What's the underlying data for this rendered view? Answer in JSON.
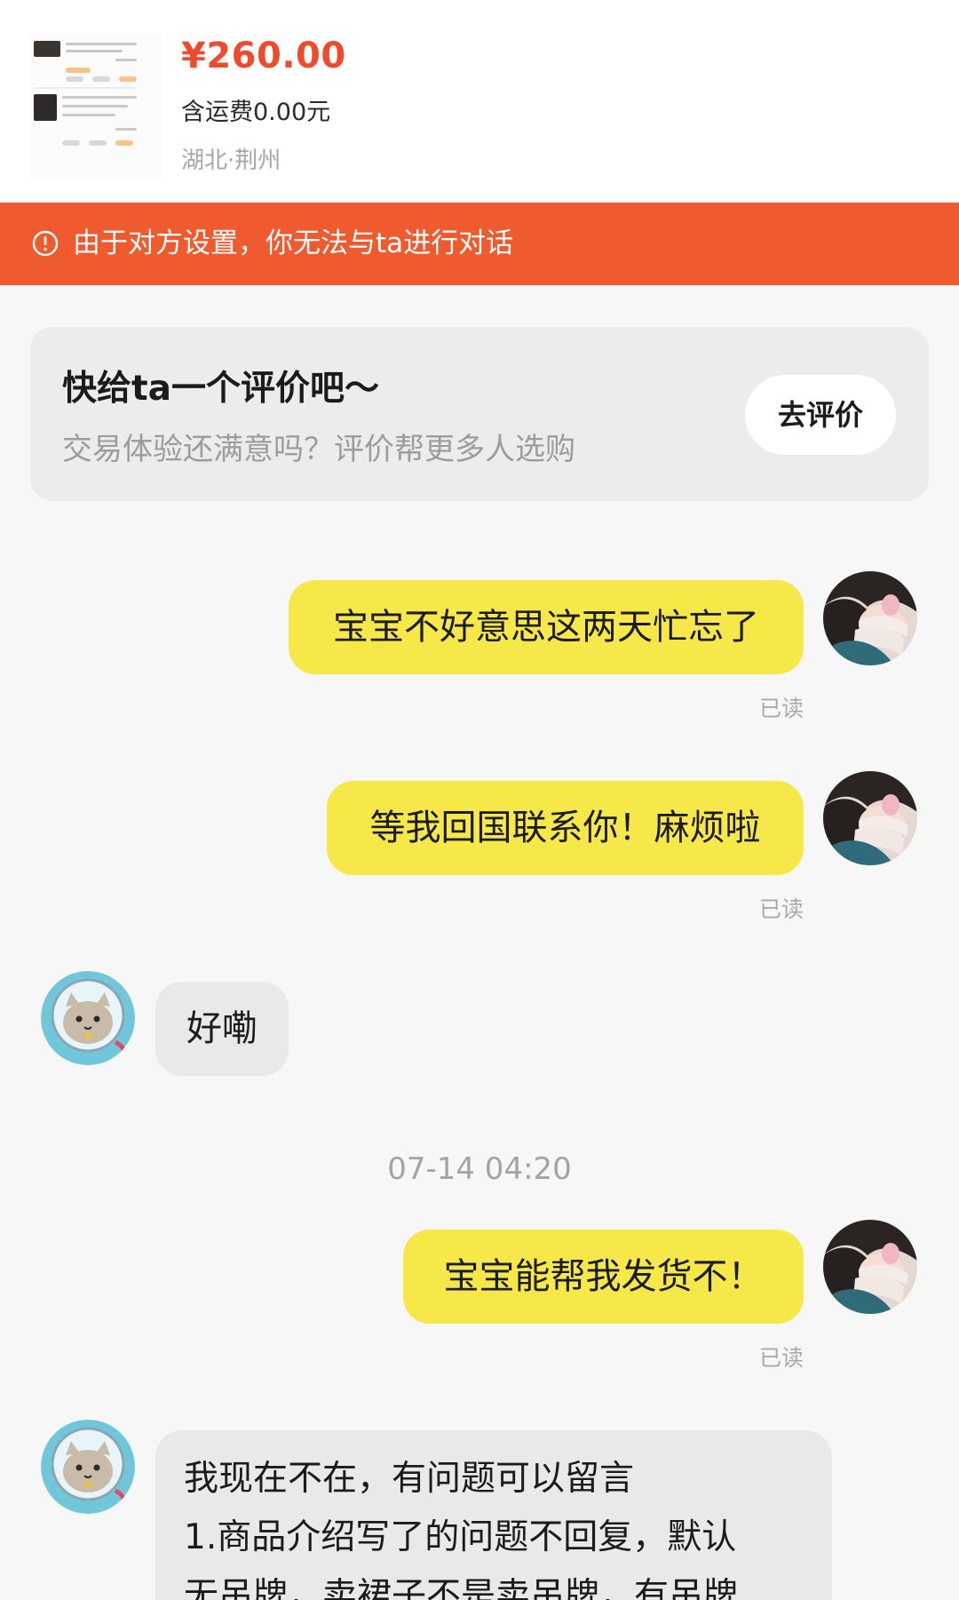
{
  "product": {
    "price": "¥260.00",
    "shipping": "含运费0.00元",
    "location": "湖北·荆州"
  },
  "banner": {
    "text": "由于对方设置，你无法与ta进行对话",
    "icon": "exclamation-circle-icon"
  },
  "rating": {
    "title": "快给ta一个评价吧～",
    "subtitle": "交易体验还满意吗？评价帮更多人选购",
    "button": "去评价"
  },
  "chat": {
    "messages": [
      {
        "from": "me",
        "text": "宝宝不好意思这两天忙忘了",
        "status": "已读"
      },
      {
        "from": "me",
        "text": "等我回国联系你！麻烦啦",
        "status": "已读"
      },
      {
        "from": "them",
        "text": "好嘞"
      },
      {
        "from": "me",
        "text": "宝宝能帮我发货不！",
        "status": "已读"
      },
      {
        "from": "them",
        "lines": [
          "我现在不在，有问题可以留言",
          "1.商品介绍写了的问题不回复，默认",
          "无吊牌，卖裙子不是卖吊牌，有吊牌"
        ]
      }
    ],
    "timestamp": "07-14 04:20"
  },
  "colors": {
    "accent_red": "#f04a2c",
    "banner_bg": "#ef5a2e",
    "my_bubble": "#f7e84a",
    "their_bubble": "#e9e9ea"
  }
}
